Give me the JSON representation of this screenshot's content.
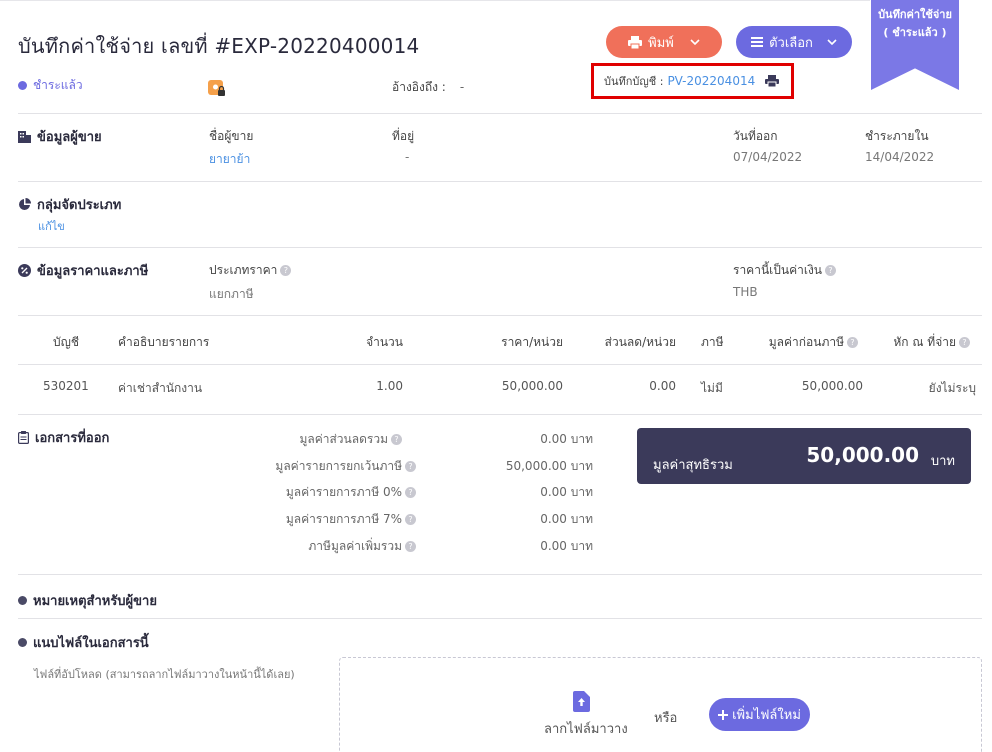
{
  "header": {
    "title": "บันทึกค่าใช้จ่าย เลขที่ #EXP-20220400014",
    "print_label": "พิมพ์",
    "options_label": "ตัวเลือก",
    "ribbon_line1": "บันทึกค่าใช้จ่าย",
    "ribbon_line2": "( ชำระแล้ว )"
  },
  "status": {
    "label": "ชำระแล้ว",
    "reference_label": "อ้างอิงถึง :",
    "reference_value": "-",
    "account_label": "บันทึกบัญชี :",
    "account_value": "PV-202204014"
  },
  "vendor": {
    "section_title": "ข้อมูลผู้ขาย",
    "name_label": "ชื่อผู้ขาย",
    "name_value": "ยายาย้า",
    "address_label": "ที่อยู่",
    "address_value": "-",
    "issue_date_label": "วันที่ออก",
    "issue_date_value": "07/04/2022",
    "due_label": "ชำระภายใน",
    "due_value": "14/04/2022"
  },
  "category": {
    "section_title": "กลุ่มจัดประเภท",
    "edit_label": "แก้ไข"
  },
  "pricing": {
    "section_title": "ข้อมูลราคาและภาษี",
    "price_type_label": "ประเภทราคา",
    "price_type_value": "แยกภาษี",
    "currency_label": "ราคานี้เป็นค่าเงิน",
    "currency_value": "THB"
  },
  "table": {
    "headers": [
      "บัญชี",
      "คำอธิบายรายการ",
      "จำนวน",
      "ราคา/หน่วย",
      "ส่วนลด/หน่วย",
      "ภาษี",
      "มูลค่าก่อนภาษี",
      "หัก ณ ที่จ่าย"
    ],
    "rows": [
      [
        "530201",
        "ค่าเช่าสำนักงาน",
        "1.00",
        "50,000.00",
        "0.00",
        "ไม่มี",
        "50,000.00",
        "ยังไม่ระบุ"
      ]
    ]
  },
  "documents": {
    "section_title": "เอกสารที่ออก"
  },
  "summary": {
    "items": [
      {
        "label": "มูลค่าส่วนลดรวม",
        "value": "0.00 บาท"
      },
      {
        "label": "มูลค่ารายการยกเว้นภาษี",
        "value": "50,000.00 บาท"
      },
      {
        "label": "มูลค่ารายการภาษี 0%",
        "value": "0.00 บาท"
      },
      {
        "label": "มูลค่ารายการภาษี 7%",
        "value": "0.00 บาท"
      },
      {
        "label": "ภาษีมูลค่าเพิ่มรวม",
        "value": "0.00 บาท"
      }
    ],
    "total_label": "มูลค่าสุทธิรวม",
    "total_value": "50,000.00",
    "total_unit": "บาท"
  },
  "notes": {
    "section_title": "หมายเหตุสำหรับผู้ขาย"
  },
  "attachments": {
    "section_title": "แนบไฟล์ในเอกสารนี้",
    "hint": "ไฟล์ที่อัปโหลด (สามารถลากไฟล์มาวางในหน้านี้ได้เลย)",
    "drag_label": "ลากไฟล์มาวาง",
    "or_label": "หรือ",
    "add_label": "เพิ่มไฟล์ใหม่"
  },
  "colors": {
    "accent": "#6c6ae0",
    "print_button": "#f0705a",
    "total_box": "#3b3a5a",
    "highlight": "#e00000",
    "link": "#4a90e2"
  }
}
